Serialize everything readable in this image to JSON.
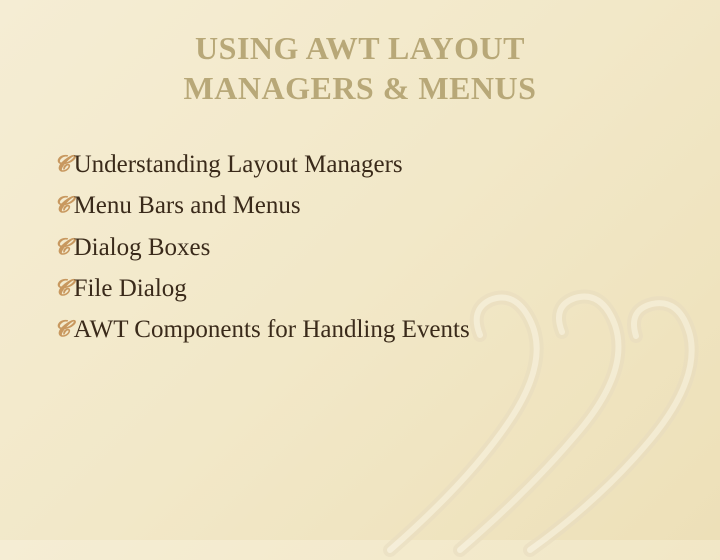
{
  "title_line1": "USING AWT LAYOUT",
  "title_line2": "MANAGERS & MENUS",
  "bullets": [
    "Understanding Layout Managers",
    "Menu Bars and Menus",
    "Dialog Boxes",
    "File Dialog",
    "AWT Components for Handling Events"
  ]
}
